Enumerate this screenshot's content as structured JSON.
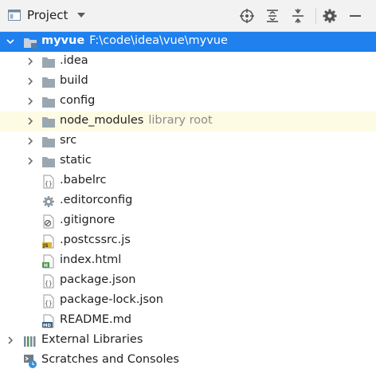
{
  "header": {
    "title": "Project",
    "toolbar": [
      "locate-icon",
      "expand-all-icon",
      "collapse-all-icon",
      "settings-icon",
      "hide-icon"
    ]
  },
  "tree": {
    "root": {
      "name": "myvue",
      "path": "F:\\code\\idea\\vue\\myvue",
      "icon": "module-folder-icon",
      "expanded": true
    },
    "folders": [
      {
        "name": ".idea"
      },
      {
        "name": "build"
      },
      {
        "name": "config"
      },
      {
        "name": "node_modules",
        "hint": "library root"
      },
      {
        "name": "src"
      },
      {
        "name": "static"
      }
    ],
    "files": [
      {
        "name": ".babelrc",
        "icon": "json-file-icon"
      },
      {
        "name": ".editorconfig",
        "icon": "config-gear-file-icon"
      },
      {
        "name": ".gitignore",
        "icon": "ignore-file-icon"
      },
      {
        "name": ".postcssrc.js",
        "icon": "js-file-icon"
      },
      {
        "name": "index.html",
        "icon": "html-file-icon"
      },
      {
        "name": "package.json",
        "icon": "json-file-icon"
      },
      {
        "name": "package-lock.json",
        "icon": "json-file-icon"
      },
      {
        "name": "README.md",
        "icon": "markdown-file-icon"
      }
    ],
    "external_libraries": {
      "name": "External Libraries",
      "icon": "libraries-icon"
    },
    "scratches": {
      "name": "Scratches and Consoles",
      "icon": "scratches-icon"
    }
  },
  "colors": {
    "selection": "#1f80ee",
    "highlight_row": "#fdfbe3",
    "folder": "#9aa7b0",
    "hint_text": "#8c8c8c"
  }
}
